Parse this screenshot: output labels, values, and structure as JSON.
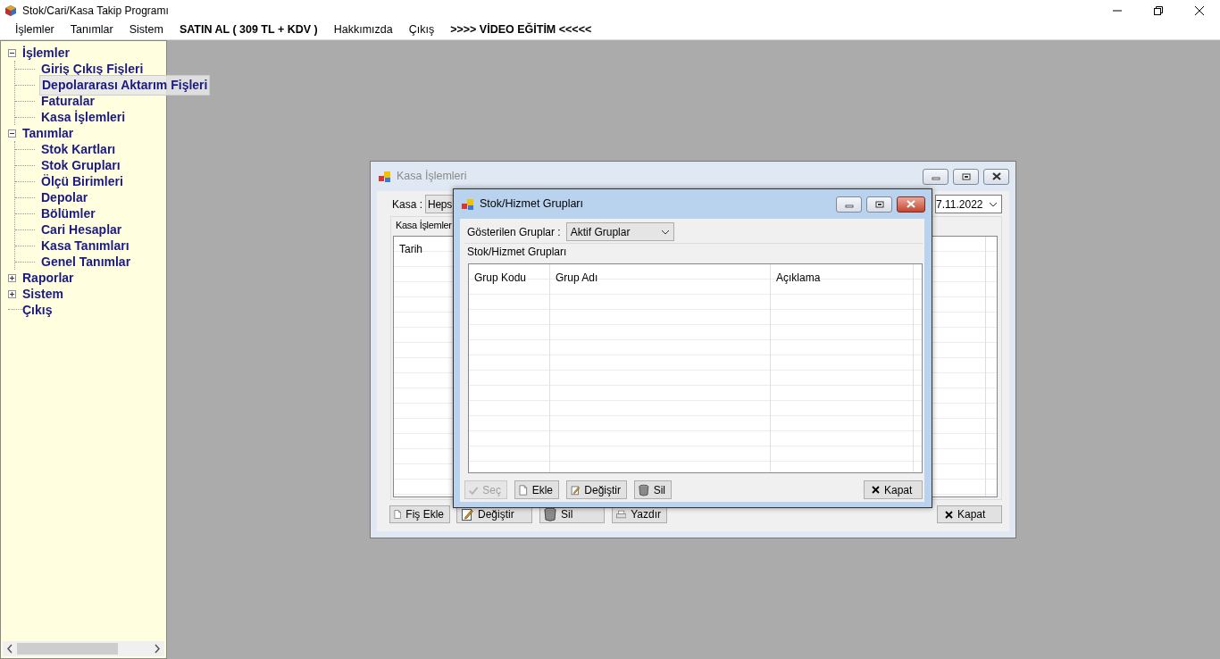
{
  "window": {
    "title": "Stok/Cari/Kasa Takip Programı"
  },
  "menu": [
    {
      "label": "İşlemler",
      "kind": "normal"
    },
    {
      "label": "Tanımlar",
      "kind": "normal"
    },
    {
      "label": "Sistem",
      "kind": "normal"
    },
    {
      "label": "SATIN AL ( 309 TL + KDV )",
      "kind": "bold"
    },
    {
      "label": "Hakkımızda",
      "kind": "normal"
    },
    {
      "label": "Çıkış",
      "kind": "normal"
    },
    {
      "label": ">>>> VİDEO EĞİTİM <<<<<",
      "kind": "bold"
    }
  ],
  "tree": [
    {
      "label": "İşlemler",
      "expanded": true,
      "children": [
        {
          "label": "Giriş Çıkış Fişleri",
          "hovered": false
        },
        {
          "label": "Depolararası Aktarım Fişleri",
          "hovered": true
        },
        {
          "label": "Faturalar",
          "hovered": false
        },
        {
          "label": "Kasa İşlemleri",
          "hovered": false
        }
      ]
    },
    {
      "label": "Tanımlar",
      "expanded": true,
      "children": [
        {
          "label": "Stok Kartları",
          "hovered": false
        },
        {
          "label": "Stok Grupları",
          "hovered": false
        },
        {
          "label": "Ölçü Birimleri",
          "hovered": false
        },
        {
          "label": "Depolar",
          "hovered": false
        },
        {
          "label": "Bölümler",
          "hovered": false
        },
        {
          "label": "Cari Hesaplar",
          "hovered": false
        },
        {
          "label": "Kasa Tanımları",
          "hovered": false
        },
        {
          "label": "Genel Tanımlar",
          "hovered": false
        }
      ]
    },
    {
      "label": "Raporlar",
      "expanded": false
    },
    {
      "label": "Sistem",
      "expanded": false
    },
    {
      "label": "Çıkış"
    }
  ],
  "kasa_window": {
    "title": "Kasa İşlemleri",
    "active": false,
    "kasa_label": "Kasa :",
    "kasa_value": "Heps",
    "date_value": "7.11.2022",
    "group_label": "Kasa İşlemler",
    "columns": [
      "Tarih"
    ],
    "buttons": [
      {
        "label": "Fiş Ekle",
        "kind": "new"
      },
      {
        "label": "Değiştir",
        "kind": "edit"
      },
      {
        "label": "Sil",
        "kind": "delete"
      },
      {
        "label": "Yazdır",
        "kind": "print"
      },
      {
        "label": "Kapat",
        "kind": "close"
      }
    ]
  },
  "groups_window": {
    "title": "Stok/Hizmet Grupları",
    "active": true,
    "filter_label": "Gösterilen Gruplar :",
    "filter_value": "Aktif Gruplar",
    "group_label": "Stok/Hizmet Grupları",
    "columns": [
      "Grup Kodu",
      "Grup Adı",
      "Açıklama"
    ],
    "buttons": [
      {
        "label": "Seç",
        "kind": "select",
        "disabled": true
      },
      {
        "label": "Ekle",
        "kind": "new",
        "disabled": false
      },
      {
        "label": "Değiştir",
        "kind": "edit",
        "disabled": false
      },
      {
        "label": "Sil",
        "kind": "delete",
        "disabled": false
      },
      {
        "label": "Kapat",
        "kind": "close",
        "disabled": false
      }
    ]
  }
}
